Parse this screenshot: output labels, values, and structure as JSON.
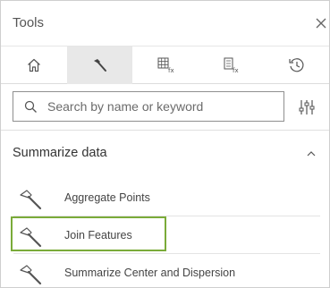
{
  "panel": {
    "title": "Tools"
  },
  "tabs": [
    {
      "icon": "home-icon"
    },
    {
      "icon": "hammer-icon",
      "active": true
    },
    {
      "icon": "table-function-icon"
    },
    {
      "icon": "list-function-icon"
    },
    {
      "icon": "history-icon"
    }
  ],
  "search": {
    "placeholder": "Search by name or keyword"
  },
  "section": {
    "title": "Summarize data",
    "expanded": true
  },
  "tools": [
    {
      "label": "Aggregate Points",
      "icon": "hammer-icon"
    },
    {
      "label": "Join Features",
      "icon": "hammer-icon",
      "highlighted": true
    },
    {
      "label": "Summarize Center and Dispersion",
      "icon": "hammer-icon"
    }
  ],
  "colors": {
    "highlight": "#7aab39",
    "active_tab": "#e8e8e8"
  }
}
